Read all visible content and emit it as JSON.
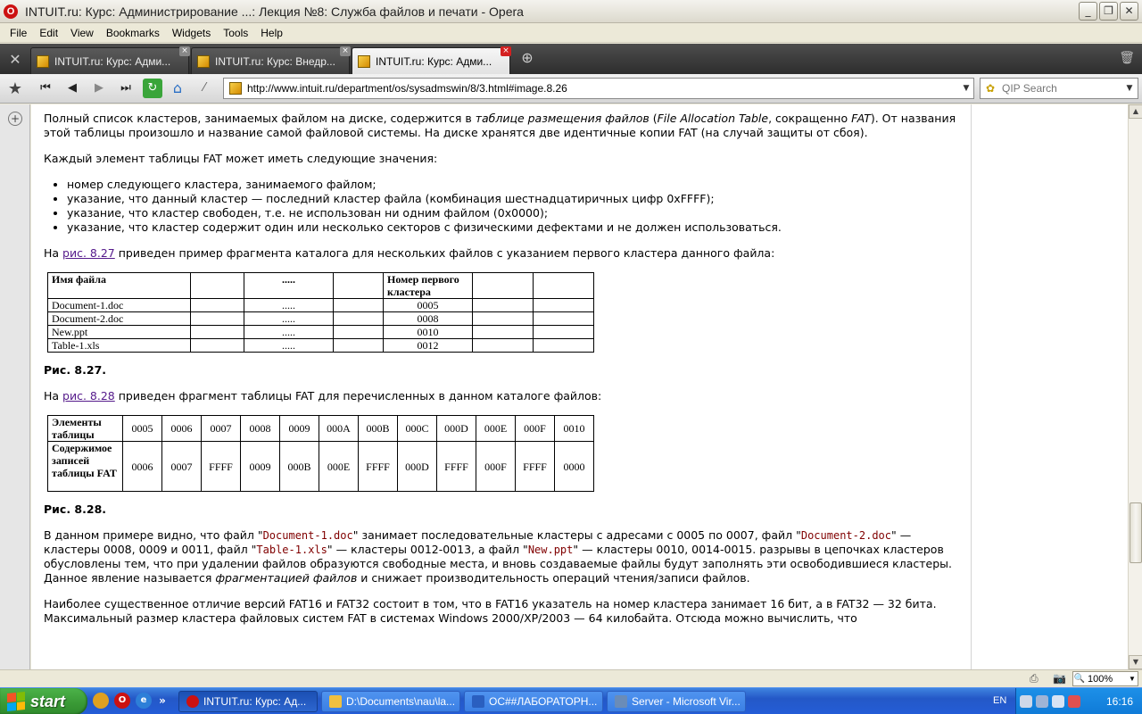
{
  "window": {
    "title": "INTUIT.ru: Курс: Администрирование ...: Лекция №8: Служба файлов и печати - Opera",
    "app_icon_letter": "O",
    "minimize": "_",
    "maximize": "❐",
    "close": "✕"
  },
  "menu": [
    "File",
    "Edit",
    "View",
    "Bookmarks",
    "Widgets",
    "Tools",
    "Help"
  ],
  "tabs": [
    {
      "label": "INTUIT.ru: Курс: Адми...",
      "active": false
    },
    {
      "label": "INTUIT.ru: Курс: Внедр...",
      "active": false
    },
    {
      "label": "INTUIT.ru: Курс: Адми...",
      "active": true
    }
  ],
  "tab_close_glyph": "×",
  "new_tab_glyph": "⊕",
  "trash_glyph": "🗑",
  "toolbar": {
    "back_glyph": "◀",
    "forward_glyph": "▶",
    "rewind_glyph": "⏮",
    "fastforward_glyph": "⏭",
    "reload_glyph": "↻",
    "home_glyph": "⌂",
    "wand_glyph": "⁄",
    "star_glyph": "★",
    "url": "http://www.intuit.ru/department/os/sysadmswin/8/3.html#image.8.26",
    "search_placeholder": "QIP Search",
    "dropdown_glyph": "▼"
  },
  "panel_add_glyph": "+",
  "article": {
    "p1": {
      "a": "Полный список кластеров, занимаемых файлом на диске, содержится в ",
      "b": "таблице размещения файлов",
      "c": " (",
      "d": "File Allocation Table",
      "e": ", сокращенно ",
      "f": "FAT",
      "g": "). От названия этой таблицы произошло и название самой файловой системы. На диске хранятся две идентичные копии FAT (на случай защиты от сбоя)."
    },
    "p2": "Каждый элемент таблицы FAT может иметь следующие значения:",
    "bullets": [
      "номер следующего кластера, занимаемого файлом;",
      "указание, что данный кластер — последний кластер файла (комбинация шестнадцатиричных цифр 0xFFFF);",
      "указание, что кластер свободен, т.е. не использован ни одним файлом (0x0000);",
      "указание, что кластер содержит один или несколько секторов с физическими дефектами и не должен использоваться."
    ],
    "p3": {
      "a": "На ",
      "link": "рис. 8.27",
      "b": " приведен пример фрагмента каталога для нескольких файлов с указанием первого кластера данного файла:"
    },
    "dir_table": {
      "header": [
        "Имя файла",
        "",
        ".....",
        "",
        "Номер первого кластера",
        "",
        ""
      ],
      "rows": [
        [
          "Document-1.doc",
          "",
          ".....",
          "",
          "0005",
          "",
          ""
        ],
        [
          "Document-2.doc",
          "",
          ".....",
          "",
          "0008",
          "",
          ""
        ],
        [
          "New.ppt",
          "",
          ".....",
          "",
          "0010",
          "",
          ""
        ],
        [
          "Table-1.xls",
          "",
          ".....",
          "",
          "0012",
          "",
          ""
        ]
      ]
    },
    "caption1": "Рис. 8.27.",
    "p4": {
      "a": "На ",
      "link": "рис. 8.28",
      "b": " приведен фрагмент таблицы FAT для перечисленных в данном каталоге файлов:"
    },
    "fat_table": {
      "row1_label": "Элементы таблицы",
      "row1": [
        "0005",
        "0006",
        "0007",
        "0008",
        "0009",
        "000A",
        "000B",
        "000C",
        "000D",
        "000E",
        "000F",
        "0010"
      ],
      "row2_label": "Содержимое записей таблицы FAT",
      "row2": [
        "0006",
        "0007",
        "FFFF",
        "0009",
        "000B",
        "000E",
        "FFFF",
        "000D",
        "FFFF",
        "000F",
        "FFFF",
        "0000"
      ]
    },
    "caption2": "Рис. 8.28.",
    "p5": {
      "a": "В данном примере видно, что файл \"",
      "f1": "Document-1.doc",
      "b": "\" занимает последовательные кластеры с адресами с 0005 по 0007, файл \"",
      "f2": "Document-2.doc",
      "c": "\" — кластеры 0008, 0009 и 0011, файл \"",
      "f3": "Table-1.xls",
      "d": "\" — кластеры 0012-0013, а файл \"",
      "f4": "New.ppt",
      "e": "\" — кластеры 0010, 0014-0015. разрывы в цепочках кластеров обусловлены тем, что при удалении файлов образуются свободные места, и вновь создаваемые файлы будут заполнять эти освободившиеся кластеры. Данное явление называется ",
      "em": "фрагментацией файлов",
      "g": " и снижает производительность операций чтения/записи файлов."
    },
    "p6": "Наиболее существенное отличие версий FAT16 и FAT32 состоит в том, что в FAT16 указатель на номер кластера занимает 16 бит, а в FAT32 — 32 бита. Максимальный размер кластера файловых систем FAT в системах Windows 2000/XP/2003 — 64 килобайта. Отсюда можно вычислить, что"
  },
  "scrollbar": {
    "up": "▲",
    "down": "▼",
    "position_fraction": 0.75
  },
  "status": {
    "zoom": "100%",
    "zoom_icon": "🔍",
    "icon1": "⎙",
    "icon2": "📷"
  },
  "taskbar": {
    "start_label": "start",
    "quicklaunch_more": "»",
    "tasks": [
      {
        "label": "INTUIT.ru: Курс: Ад...",
        "active": true,
        "color": "#cc1111"
      },
      {
        "label": "D:\\Documents\\nau\\la...",
        "active": false,
        "color": "#f0c040"
      },
      {
        "label": "ОС##ЛАБОРАТОРН...",
        "active": false,
        "color": "#2a5fc0"
      },
      {
        "label": "Server - Microsoft Vir...",
        "active": false,
        "color": "#6a8cb8"
      }
    ],
    "lang": "EN",
    "clock": "16:16"
  }
}
